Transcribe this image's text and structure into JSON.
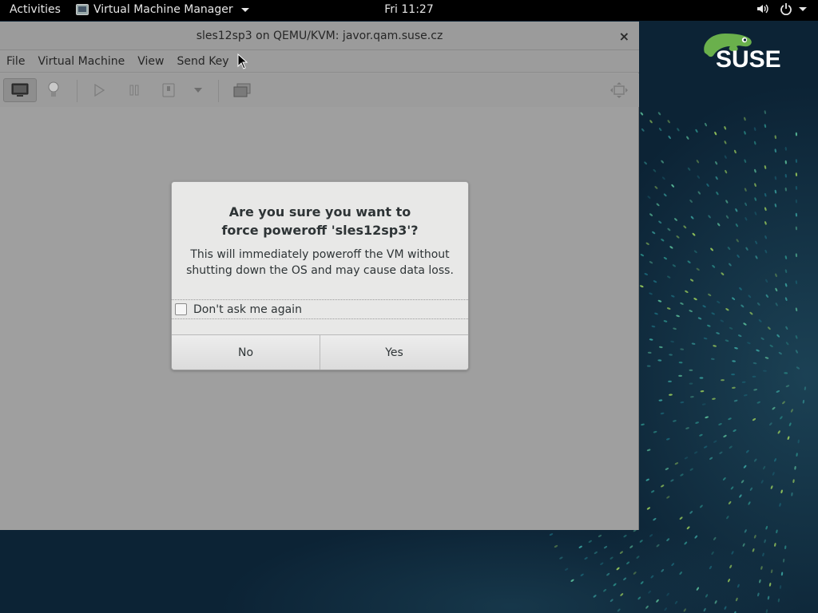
{
  "topbar": {
    "activities": "Activities",
    "app_menu": "Virtual Machine Manager",
    "clock": "Fri 11:27",
    "icons": [
      "volume-icon",
      "power-icon",
      "chevron-down-icon"
    ]
  },
  "desktop": {
    "logo_text": "SUSE",
    "logo_color": "#ffffff",
    "accent_green": "#6ab04c",
    "background": "#0c2335"
  },
  "window": {
    "title": "sles12sp3 on QEMU/KVM: javor.qam.suse.cz",
    "close_glyph": "×",
    "menu": [
      "File",
      "Virtual Machine",
      "View",
      "Send Key"
    ],
    "toolbar": [
      "console-icon",
      "details-lightbulb-icon",
      "run-icon",
      "pause-icon",
      "shutdown-icon",
      "shutdown-menu-chevron-icon",
      "snapshots-icon",
      "fullscreen-icon"
    ]
  },
  "dialog": {
    "heading_line1": "Are you sure you want to",
    "heading_line2": "force poweroff 'sles12sp3'?",
    "body_line1": "This will immediately poweroff the VM without",
    "body_line2": "shutting down the OS and may cause data loss.",
    "checkbox_label": "Don't ask me again",
    "checkbox_checked": false,
    "buttons": {
      "no": "No",
      "yes": "Yes"
    }
  }
}
